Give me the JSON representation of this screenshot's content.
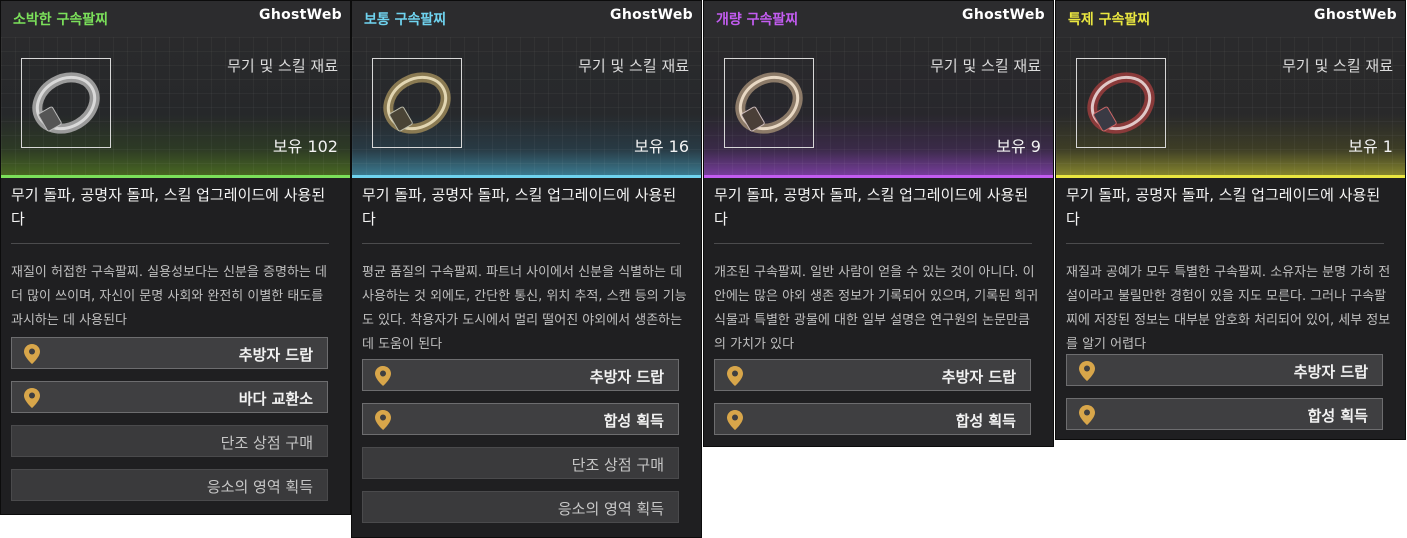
{
  "watermark": "GhostWeb",
  "colors": {
    "green": "#7be05a",
    "cyan": "#6fd3ef",
    "purple": "#c25cf0",
    "yellow": "#e9e640",
    "pin": "#d8a64a"
  },
  "cards": [
    {
      "title": "소박한 구속팔찌",
      "category": "무기 및 스킬 재료",
      "owned": "보유 102",
      "description": "무기 돌파, 공명자 돌파, 스킬 업그레이드에 사용된다",
      "flavor": "재질이 허접한 구속팔찌. 실용성보다는 신분을 증명하는 데 더 많이 쓰이며, 자신이 문명 사회와 완전히 이별한 태도를 과시하는 데 사용된다",
      "sources": [
        {
          "label": "추방자 드랍",
          "has_pin": true
        },
        {
          "label": "바다 교환소",
          "has_pin": true
        },
        {
          "label": "단조 상점 구매",
          "has_pin": false
        },
        {
          "label": "응소의 영역 획득",
          "has_pin": false
        }
      ]
    },
    {
      "title": "보통 구속팔찌",
      "category": "무기 및 스킬 재료",
      "owned": "보유 16",
      "description": "무기 돌파, 공명자 돌파, 스킬 업그레이드에 사용된다",
      "flavor": "평균 품질의 구속팔찌. 파트너 사이에서 신분을 식별하는 데 사용하는 것 외에도, 간단한 통신, 위치 추적, 스캔 등의 기능도 있다. 착용자가 도시에서 멀리 떨어진 야외에서 생존하는 데 도움이 된다",
      "sources": [
        {
          "label": "추방자 드랍",
          "has_pin": true
        },
        {
          "label": "합성 획득",
          "has_pin": true
        },
        {
          "label": "단조 상점 구매",
          "has_pin": false
        },
        {
          "label": "응소의 영역 획득",
          "has_pin": false
        }
      ]
    },
    {
      "title": "개량 구속팔찌",
      "category": "무기 및 스킬 재료",
      "owned": "보유 9",
      "description": "무기 돌파, 공명자 돌파, 스킬 업그레이드에 사용된다",
      "flavor": "개조된 구속팔찌. 일반 사람이 얻을 수 있는 것이 아니다. 이 안에는 많은 야외 생존 정보가 기록되어 있으며, 기록된 희귀 식물과 특별한 광물에 대한 일부 설명은 연구원의 논문만큼의 가치가 있다",
      "sources": [
        {
          "label": "추방자 드랍",
          "has_pin": true
        },
        {
          "label": "합성 획득",
          "has_pin": true
        }
      ]
    },
    {
      "title": "특제 구속팔찌",
      "category": "무기 및 스킬 재료",
      "owned": "보유 1",
      "description": "무기 돌파, 공명자 돌파, 스킬 업그레이드에 사용된다",
      "flavor": "재질과 공예가 모두 특별한 구속팔찌. 소유자는 분명 가히 전설이라고 불릴만한 경험이 있을 지도 모른다. 그러나 구속팔찌에 저장된 정보는 대부분 암호화 처리되어 있어, 세부 정보를 알기 어렵다",
      "sources": [
        {
          "label": "추방자 드랍",
          "has_pin": true
        },
        {
          "label": "합성 획득",
          "has_pin": true
        }
      ]
    }
  ]
}
